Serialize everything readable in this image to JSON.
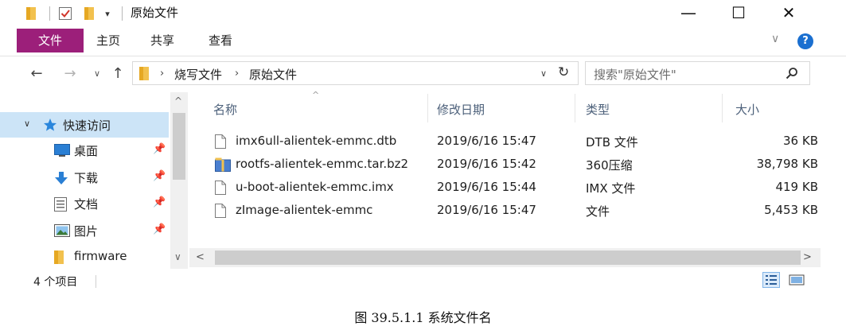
{
  "window": {
    "title": "原始文件",
    "controls": {
      "minimize": "—",
      "maximize": "☐",
      "close": "✕"
    }
  },
  "quick_access_toolbar": {
    "dropdown": "▾",
    "icons": [
      "folder-icon",
      "properties-check-icon",
      "new-folder-icon"
    ]
  },
  "ribbon": {
    "tabs": [
      "文件",
      "主页",
      "共享",
      "查看"
    ],
    "active_tab_color": "#9c1f7a",
    "expand": "∨",
    "help": "?"
  },
  "address": {
    "back": "←",
    "forward": "→",
    "recent": "∨",
    "up": "↑",
    "sep": "›",
    "breadcrumbs": [
      "烧写文件",
      "原始文件"
    ],
    "dropdown": "∨",
    "refresh": "↻"
  },
  "search": {
    "placeholder": "搜索\"原始文件\""
  },
  "nav_pane": {
    "expand": "∨",
    "quick_access": "快速访问",
    "items": [
      {
        "label": "桌面",
        "icon": "desktop-icon",
        "pinned": true
      },
      {
        "label": "下载",
        "icon": "download-icon",
        "pinned": true
      },
      {
        "label": "文档",
        "icon": "documents-icon",
        "pinned": true
      },
      {
        "label": "图片",
        "icon": "pictures-icon",
        "pinned": true
      },
      {
        "label": "firmware",
        "icon": "folder-icon",
        "pinned": false
      }
    ],
    "pin_glyph": "📌",
    "selected_color": "#cce4f7"
  },
  "file_list": {
    "columns": [
      "名称",
      "修改日期",
      "类型",
      "大小"
    ],
    "sort_indicator": "^",
    "rows": [
      {
        "name": "imx6ull-alientek-emmc.dtb",
        "date": "2019/6/16 15:47",
        "type": "DTB 文件",
        "size": "36 KB",
        "icon": "generic-file-icon"
      },
      {
        "name": "rootfs-alientek-emmc.tar.bz2",
        "date": "2019/6/16 15:42",
        "type": "360压缩",
        "size": "38,798 KB",
        "icon": "archive-icon"
      },
      {
        "name": "u-boot-alientek-emmc.imx",
        "date": "2019/6/16 15:44",
        "type": "IMX 文件",
        "size": "419 KB",
        "icon": "generic-file-icon"
      },
      {
        "name": "zImage-alientek-emmc",
        "date": "2019/6/16 15:47",
        "type": "文件",
        "size": "5,453 KB",
        "icon": "generic-file-icon"
      }
    ]
  },
  "scroll": {
    "up": "^",
    "down": "∨",
    "left": "<",
    "right": ">"
  },
  "status_bar": {
    "count": "4 个项目"
  },
  "caption": "图 39.5.1.1 系统文件名"
}
